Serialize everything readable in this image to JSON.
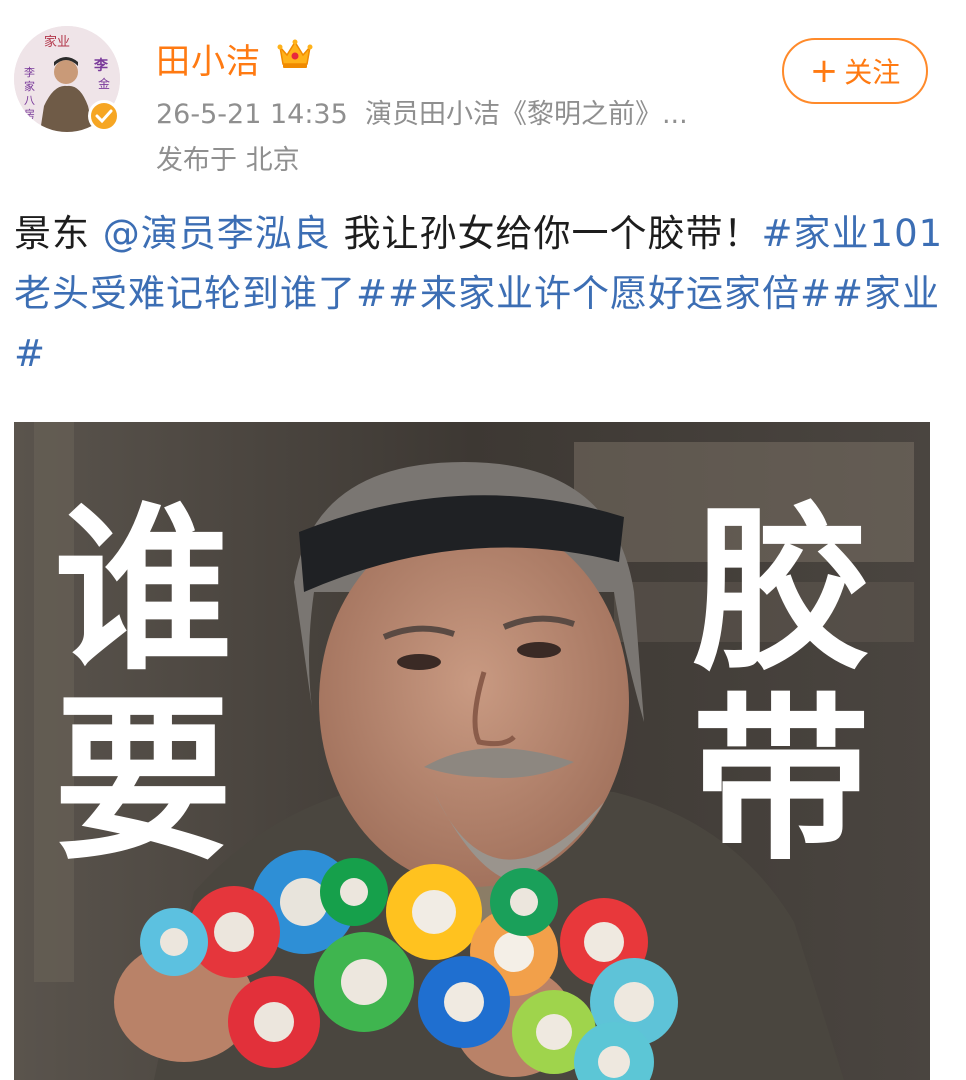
{
  "user": {
    "name": "田小洁",
    "avatar_text_top": "家业",
    "avatar_text_side": "李家八房",
    "avatar_text_name": "李金火"
  },
  "post_meta": {
    "time": "26-5-21 14:35",
    "source": "演员田小洁《黎明之前》...",
    "location": "发布于 北京"
  },
  "follow": {
    "plus": "+",
    "label": "关注"
  },
  "post": {
    "prefix": "景东 ",
    "mention": "@演员李泓良",
    "text": " 我让孙女给你一个胶带！",
    "hashtags": "#家业101老头受难记轮到谁了##来家业许个愿好运家倍##家业#"
  },
  "image": {
    "caption_left": "谁要",
    "caption_right": "胶带",
    "caption_left_1": "谁",
    "caption_left_2": "要",
    "caption_right_1": "胶",
    "caption_right_2": "带"
  },
  "colors": {
    "username": "#ff7a12",
    "link": "#3c6eb4",
    "meta": "#8f8f8f",
    "verified": "#f6a623"
  },
  "icons": [
    "crown-icon",
    "verified-icon",
    "plus-icon"
  ]
}
